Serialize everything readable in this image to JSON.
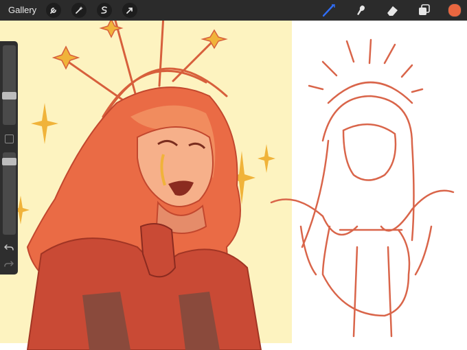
{
  "topbar": {
    "gallery_label": "Gallery",
    "left_tools": [
      "wrench-icon",
      "magic-wand-icon",
      "selection-icon",
      "transform-arrow-icon"
    ],
    "right_tools": [
      "brush-icon",
      "smudge-icon",
      "eraser-icon",
      "layers-icon"
    ],
    "brush_active_color": "#2f6df6",
    "current_color": "#ea6740"
  },
  "sidebar": {
    "brush_size_level": 0.55,
    "opacity_level": 0.08
  },
  "colors": {
    "background_yellow": "#fdf3c0",
    "hair_orange": "#ea6b45",
    "robe_red": "#c94a35",
    "skin": "#f6b08a",
    "line": "#c2472e",
    "sketch_line": "#d9654a"
  }
}
